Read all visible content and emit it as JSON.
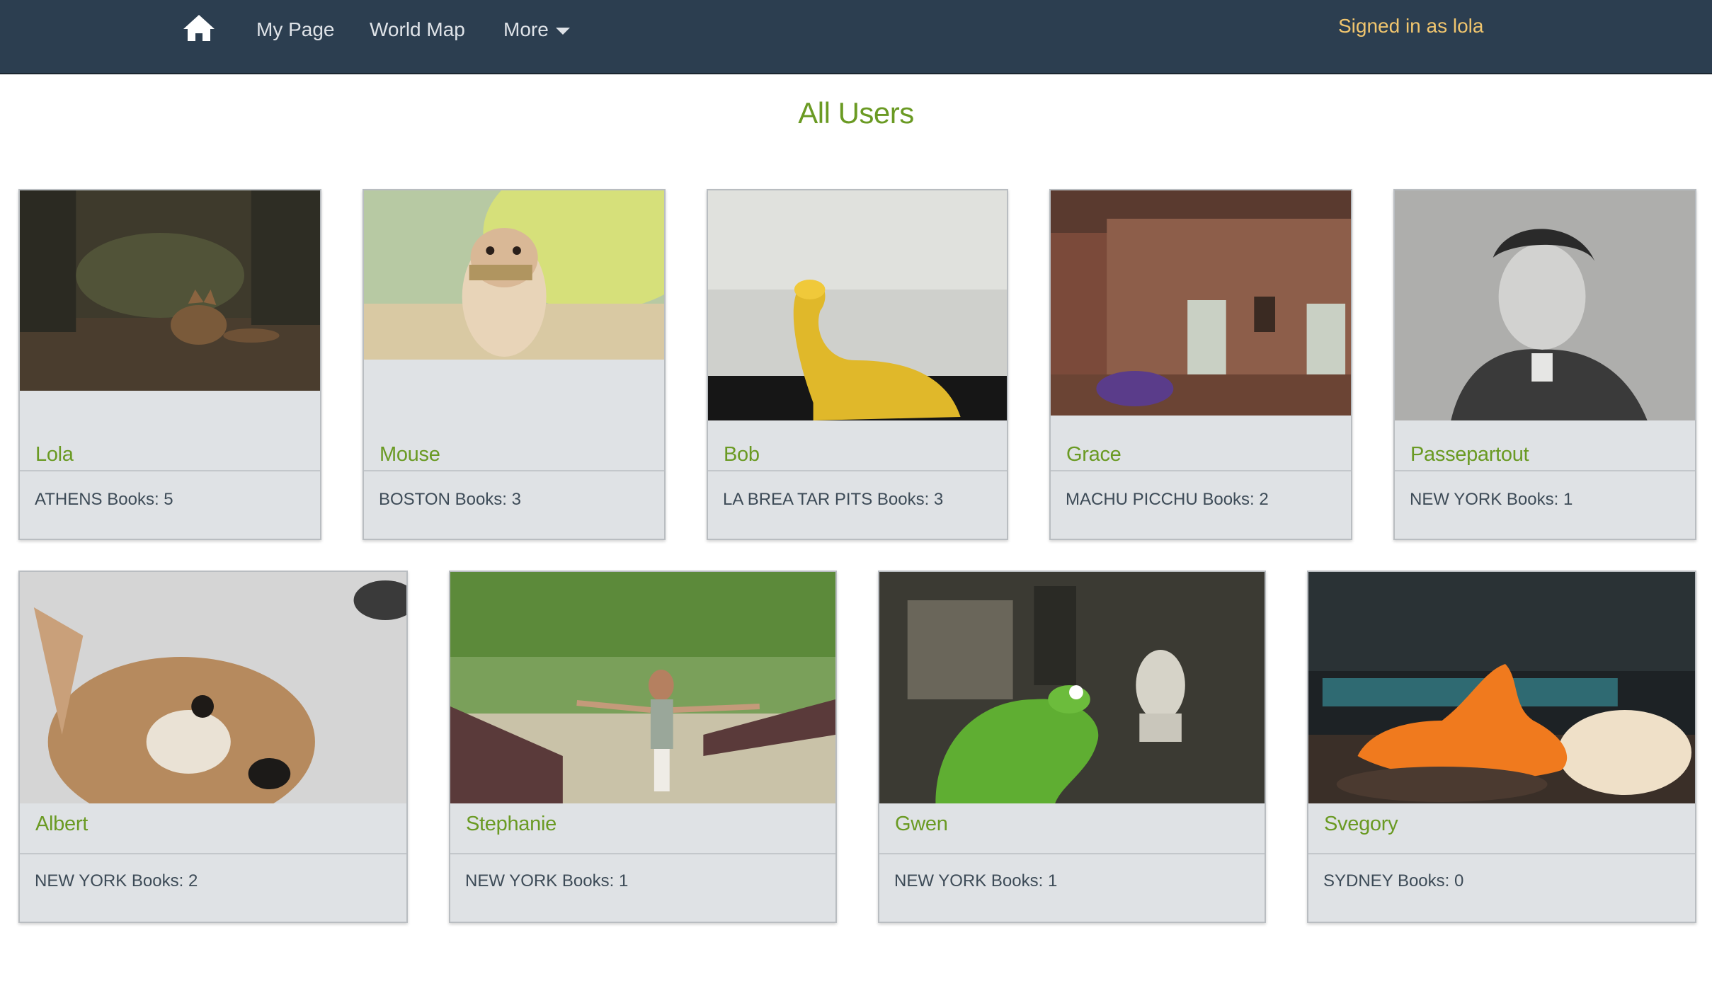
{
  "nav": {
    "home_icon": "home-icon",
    "links": [
      "My Page",
      "World Map",
      "More"
    ],
    "signed_in": "Signed in as lola"
  },
  "page_title": "All Users",
  "users": [
    {
      "name": "Lola",
      "location": "ATHENS",
      "books_label": "Books: 5",
      "photo": "fox in forest"
    },
    {
      "name": "Mouse",
      "location": "BOSTON",
      "books_label": "Books: 3",
      "photo": "hamster with harmonica"
    },
    {
      "name": "Bob",
      "location": "LA BREA TAR PITS",
      "books_label": "Books: 3",
      "photo": "yellow toy dinosaur"
    },
    {
      "name": "Grace",
      "location": "MACHU PICCHU",
      "books_label": "Books: 2",
      "photo": "stone ruins with purple dinosaur"
    },
    {
      "name": "Passepartout",
      "location": "NEW YORK",
      "books_label": "Books: 1",
      "photo": "engraved portrait"
    },
    {
      "name": "Albert",
      "location": "NEW YORK",
      "books_label": "Books: 2",
      "photo": "chihuahua dog"
    },
    {
      "name": "Stephanie",
      "location": "NEW YORK",
      "books_label": "Books: 1",
      "photo": "woman in park"
    },
    {
      "name": "Gwen",
      "location": "NEW YORK",
      "books_label": "Books: 1",
      "photo": "green puppet in room"
    },
    {
      "name": "Svegory",
      "location": "SYDNEY",
      "books_label": "Books: 0",
      "photo": "orange toy dinosaur with drink"
    }
  ],
  "colors": {
    "navbar": "#2c3e50",
    "accent": "#6a9a23",
    "signed_in": "#f0c56e",
    "card_bg": "#dfe2e5"
  }
}
